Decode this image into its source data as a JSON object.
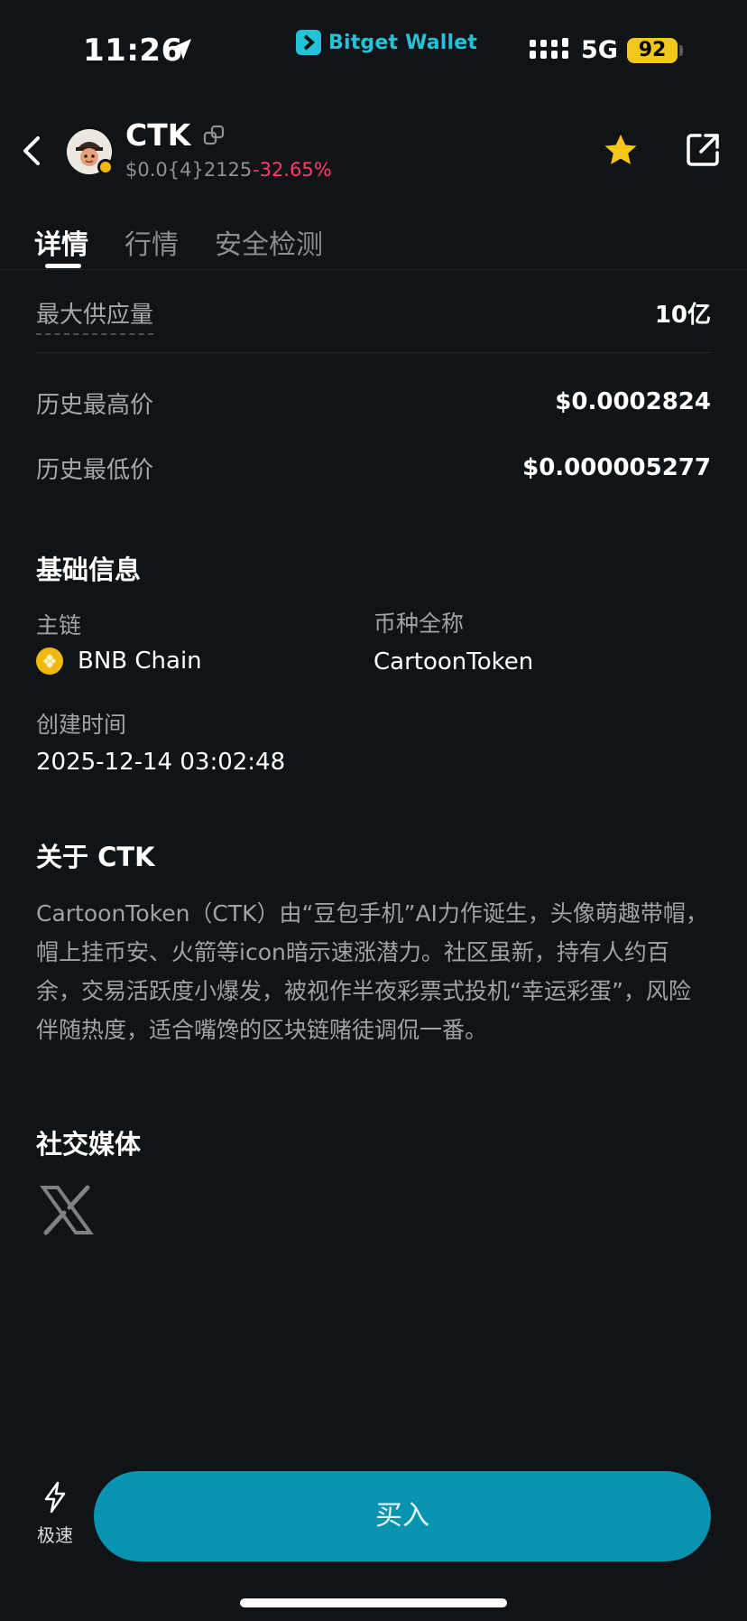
{
  "status_bar": {
    "time": "11:26",
    "brand": "Bitget Wallet",
    "network": "5G",
    "battery": "92"
  },
  "header": {
    "symbol": "CTK",
    "price": "$0.0{4}2125",
    "change": "-32.65%",
    "change_color": "#ff3b6b",
    "icons": [
      "back-icon",
      "copy-icon",
      "star-icon",
      "share-icon"
    ]
  },
  "tabs": [
    {
      "label": "详情",
      "active": true
    },
    {
      "label": "行情",
      "active": false
    },
    {
      "label": "安全检测",
      "active": false
    }
  ],
  "stats": {
    "max_supply_label": "最大供应量",
    "max_supply_value": "10亿",
    "ath_label": "历史最高价",
    "ath_value": "$0.0002824",
    "atl_label": "历史最低价",
    "atl_value": "$0.000005277"
  },
  "basic_info": {
    "title": "基础信息",
    "chain_label": "主链",
    "chain_value": "BNB Chain",
    "fullname_label": "币种全称",
    "fullname_value": "CartoonToken",
    "created_label": "创建时间",
    "created_value": "2025-12-14 03:02:48"
  },
  "about": {
    "title": "关于 CTK",
    "text": "CartoonToken（CTK）由“豆包手机”AI力作诞生，头像萌趣带帽，帽上挂币安、火箭等icon暗示速涨潜力。社区虽新，持有人约百余，交易活跃度小爆发，被视作半夜彩票式投机“幸运彩蛋”，风险伴随热度，适合嘴馋的区块链赌徒调侃一番。"
  },
  "social": {
    "title": "社交媒体",
    "links": [
      "x-icon"
    ]
  },
  "bottom_bar": {
    "speed_label": "极速",
    "buy_label": "买入",
    "buy_color": "#0993b2"
  },
  "colors": {
    "background": "#111416",
    "brand_accent": "#22c3d8",
    "star": "#f5c518",
    "battery": "#f2c81b"
  }
}
